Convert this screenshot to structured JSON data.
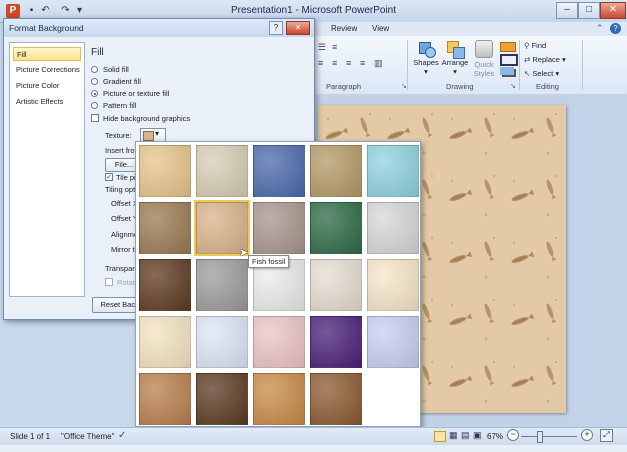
{
  "window": {
    "title": "Presentation1 - Microsoft PowerPoint",
    "controls": {
      "minimize": "–",
      "maximize": "□",
      "close": "✕"
    }
  },
  "quick_access": {
    "app_icon_letter": "P"
  },
  "ribbon": {
    "tabs": [
      "Review",
      "View"
    ],
    "groups": {
      "paragraph": "Paragraph",
      "drawing": "Drawing",
      "editing": "Editing"
    },
    "drawing_buttons": {
      "shapes": "Shapes",
      "arrange": "Arrange",
      "quick_styles_1": "Quick",
      "quick_styles_2": "Styles"
    },
    "editing_buttons": {
      "find": "Find",
      "replace": "Replace",
      "select": "Select"
    }
  },
  "dialog": {
    "title": "Format Background",
    "help": "?",
    "close": "✕",
    "nav": [
      "Fill",
      "Picture Corrections",
      "Picture Color",
      "Artistic Effects"
    ],
    "section_title": "Fill",
    "fill_options": [
      {
        "label": "Solid fill",
        "selected": false
      },
      {
        "label": "Gradient fill",
        "selected": false
      },
      {
        "label": "Picture or texture fill",
        "selected": true
      },
      {
        "label": "Pattern fill",
        "selected": false
      }
    ],
    "hide_graphics": "Hide background graphics",
    "texture_label": "Texture:",
    "insert_from": "Insert from",
    "file_button": "File...",
    "tile_label": "Tile pic",
    "tiling_options": "Tiling option",
    "offset_x": "Offset X:",
    "offset_y": "Offset Y:",
    "alignment": "Alignmen",
    "mirror_type": "Mirror typ",
    "transparency": "Transparen",
    "rotate": "Rotate",
    "reset_button": "Reset Backgr"
  },
  "texture_gallery": {
    "hover_tooltip": "Fish fossil",
    "textures": [
      {
        "name": "Papyrus",
        "color": "#e6c58c"
      },
      {
        "name": "Canvas",
        "color": "#d8cdb4"
      },
      {
        "name": "Denim",
        "color": "#4b6aac"
      },
      {
        "name": "Woven mat",
        "color": "#b49a66"
      },
      {
        "name": "Water droplets",
        "color": "#8fd3e0"
      },
      {
        "name": "Paper bag",
        "color": "#9b7a52"
      },
      {
        "name": "Fish fossil",
        "color": "#d9b48a"
      },
      {
        "name": "Sand",
        "color": "#a8968c"
      },
      {
        "name": "Green marble",
        "color": "#2d6a45"
      },
      {
        "name": "White marble",
        "color": "#d7d7d8"
      },
      {
        "name": "Brown marble",
        "color": "#5e3a20"
      },
      {
        "name": "Granite",
        "color": "#9c9c9c"
      },
      {
        "name": "Newsprint",
        "color": "#ebebea"
      },
      {
        "name": "Recycled paper",
        "color": "#e6ddd0"
      },
      {
        "name": "Parchment",
        "color": "#f7e7c9"
      },
      {
        "name": "Stationery",
        "color": "#f4e4bf"
      },
      {
        "name": "Blue tissue paper",
        "color": "#dbe6f5"
      },
      {
        "name": "Pink tissue paper",
        "color": "#ecc4c8"
      },
      {
        "name": "Purple mesh",
        "color": "#4a1f78"
      },
      {
        "name": "Bouquet",
        "color": "#c8d0f0"
      },
      {
        "name": "Cork",
        "color": "#b97f4d"
      },
      {
        "name": "Walnut",
        "color": "#5b3a22"
      },
      {
        "name": "Oak",
        "color": "#c98a47"
      },
      {
        "name": "Medium wood",
        "color": "#8c5a30"
      }
    ]
  },
  "status_bar": {
    "slide": "Slide 1 of 1",
    "theme": "\"Office Theme\"",
    "zoom": "67%",
    "zoom_level": 0.67
  }
}
